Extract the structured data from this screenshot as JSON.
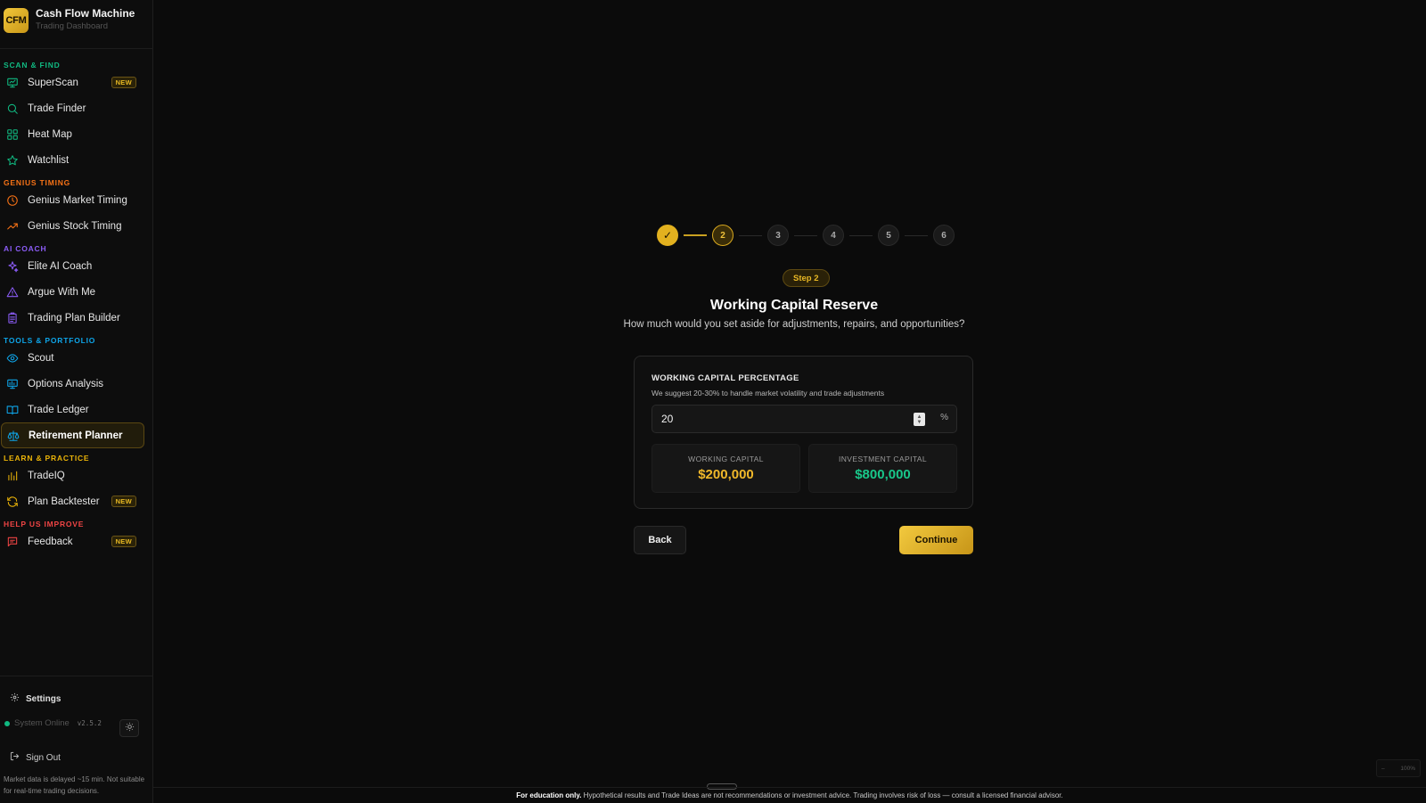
{
  "brand": {
    "logo": "CFM",
    "title": "Cash Flow Machine",
    "subtitle": "Trading Dashboard"
  },
  "sidebar": {
    "sections": [
      {
        "label": "SCAN & FIND",
        "color": "#10b981",
        "items": [
          {
            "label": "SuperScan",
            "icon": "monitor-icon",
            "badge": "NEW"
          },
          {
            "label": "Trade Finder",
            "icon": "search-icon"
          },
          {
            "label": "Heat Map",
            "icon": "grid-icon"
          },
          {
            "label": "Watchlist",
            "icon": "star-icon"
          }
        ]
      },
      {
        "label": "GENIUS TIMING",
        "color": "#f97316",
        "items": [
          {
            "label": "Genius Market Timing",
            "icon": "clock-icon"
          },
          {
            "label": "Genius Stock Timing",
            "icon": "trending-up-icon"
          }
        ]
      },
      {
        "label": "AI COACH",
        "color": "#8b5cf6",
        "items": [
          {
            "label": "Elite AI Coach",
            "icon": "sparkles-icon"
          },
          {
            "label": "Argue With Me",
            "icon": "warning-triangle-icon"
          },
          {
            "label": "Trading Plan Builder",
            "icon": "clipboard-icon"
          }
        ]
      },
      {
        "label": "TOOLS & PORTFOLIO",
        "color": "#0ea5e9",
        "items": [
          {
            "label": "Scout",
            "icon": "eye-icon"
          },
          {
            "label": "Options Analysis",
            "icon": "chart-monitor-icon"
          },
          {
            "label": "Trade Ledger",
            "icon": "book-icon"
          },
          {
            "label": "Retirement Planner",
            "icon": "scale-icon",
            "active": true
          }
        ]
      },
      {
        "label": "LEARN & PRACTICE",
        "color": "#eab308",
        "items": [
          {
            "label": "TradeIQ",
            "icon": "bar-chart-icon"
          },
          {
            "label": "Plan Backtester",
            "icon": "refresh-icon",
            "badge": "NEW"
          }
        ]
      },
      {
        "label": "HELP US IMPROVE",
        "color": "#ef4444",
        "items": [
          {
            "label": "Feedback",
            "icon": "message-icon",
            "badge": "NEW"
          }
        ]
      }
    ],
    "settings_label": "Settings",
    "status_text": "System Online",
    "version": "v2.5.2",
    "signout_label": "Sign Out",
    "disclaimer": "Market data is delayed ~15 min. Not suitable for real-time trading decisions."
  },
  "wizard": {
    "steps": [
      {
        "label": "✓",
        "state": "done"
      },
      {
        "label": "2",
        "state": "current"
      },
      {
        "label": "3",
        "state": "pending"
      },
      {
        "label": "4",
        "state": "pending"
      },
      {
        "label": "5",
        "state": "pending"
      },
      {
        "label": "6",
        "state": "pending"
      }
    ],
    "step_pill": "Step 2",
    "title": "Working Capital Reserve",
    "subtitle": "How much would you set aside for adjustments, repairs, and opportunities?",
    "card": {
      "label": "WORKING CAPITAL PERCENTAGE",
      "hint": "We suggest 20-30% to handle market volatility and trade adjustments",
      "value": "20",
      "unit": "%",
      "working_label": "WORKING CAPITAL",
      "working_value": "$200,000",
      "investment_label": "INVESTMENT CAPITAL",
      "investment_value": "$800,000"
    },
    "back_label": "Back",
    "continue_label": "Continue"
  },
  "zoom": {
    "minus": "–",
    "level": "100%"
  },
  "footer": {
    "bold": "For education only.",
    "text": " Hypothetical results and Trade Ideas are not recommendations or investment advice. Trading involves risk of loss — consult a licensed financial advisor."
  },
  "colors": {
    "accent": "#e2b11f",
    "positive": "#19c78a",
    "background": "#0b0b0b"
  }
}
